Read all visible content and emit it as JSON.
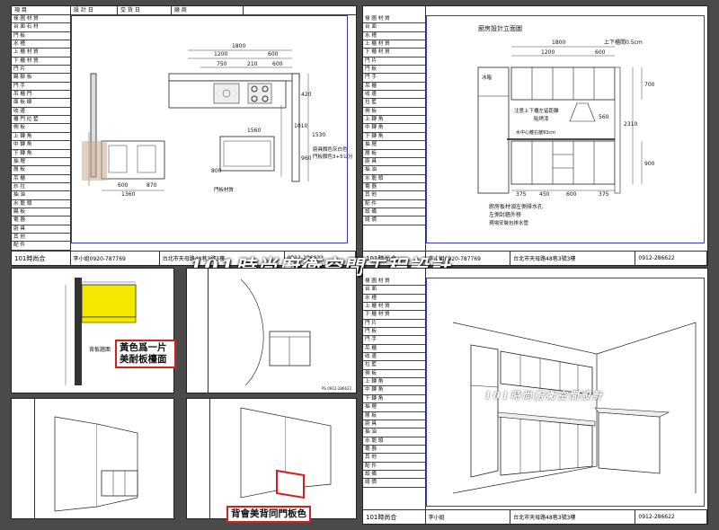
{
  "title_block": {
    "header": [
      "項 目",
      "設 計 日",
      "交 貨 日",
      "廠 商"
    ],
    "rows": [
      "樣 圖 材 質",
      "台 面 石 材",
      "門 板",
      "水 槽",
      "上 櫃 材 質",
      "下 櫃 材 質",
      "門 片",
      "踢 腳 板",
      "門 手",
      "吊 櫃 門",
      "面 板 線",
      "收 邊",
      "櫃 門 拉 籃",
      "側 板",
      "上 轉 角",
      "中 轉 角",
      "下 轉 角",
      "抽 屜",
      "層 板",
      "吊 櫃",
      "炒 拉",
      "抽 油",
      "水 龍 頭",
      "踢 板",
      "電 器",
      "廚 具",
      "其 他",
      "配 件",
      "設 備",
      "總 價"
    ],
    "rows_right": [
      "樣 圖 材 質",
      "台 面",
      "水 槽",
      "上 櫃 材 質",
      "下 櫃 材 質",
      "門 片",
      "門 板",
      "門 手",
      "吊 櫃",
      "收 邊",
      "拉 籃",
      "側 板",
      "上 轉 角",
      "中 轉 角",
      "下 轉 角",
      "抽 屜",
      "層 板",
      "廚 具",
      "抽 油",
      "水 龍 頭",
      "電 器",
      "其 他",
      "配 件",
      "設 備",
      "總 價"
    ],
    "company": "101時尚合",
    "contact_1": "李小姐0920-787769",
    "contact_2": "李小姐",
    "address": "台北市天母路48巷3號3樓",
    "phone": "0912-286622",
    "small_id": "PS 0912-286622"
  },
  "banner": {
    "main": "101時尚廚衛空間工程設計",
    "small": "101時尚廚衛空間設計"
  },
  "top_left": {
    "dims_top": [
      "1800",
      "1200",
      "600",
      "750",
      "210",
      "600"
    ],
    "dims_left": [
      "1360",
      "600",
      "870"
    ],
    "dims_side": [
      "1010",
      "1560",
      "1530",
      "420",
      "800",
      "960"
    ],
    "note_1": "廚具顏色灰白色",
    "note_2": "門板顏色3+5公分",
    "label_bottom": "門板材質"
  },
  "top_right": {
    "title": "廚房設計立面圖",
    "subtitle": "上下櫃間0.5cm",
    "dims_top": [
      "1800",
      "1200",
      "600"
    ],
    "dims_bottom": [
      "375",
      "450",
      "600",
      "375"
    ],
    "dims_side": [
      "700",
      "2310",
      "900",
      "560"
    ],
    "label_mid_1": "注意上下櫃左留距離",
    "label_mid_2": "貼烤漆",
    "label_mid_3": "冰箱",
    "label_mid_4": "水中心離右牆93cm",
    "note_1": "廚房板材須左側排水孔",
    "note_2": "左側封牆外移",
    "note_3": "現場安裝包排水管"
  },
  "callouts": {
    "yellow_label": "黃色爲一片美耐板檯面",
    "gray_label": "背板牆面",
    "red_label": "背會美背同門板色"
  },
  "colors": {
    "accent_red": "#d21f1f",
    "highlight_yellow": "#f5e800",
    "frame_blue": "#3a3ab0"
  }
}
